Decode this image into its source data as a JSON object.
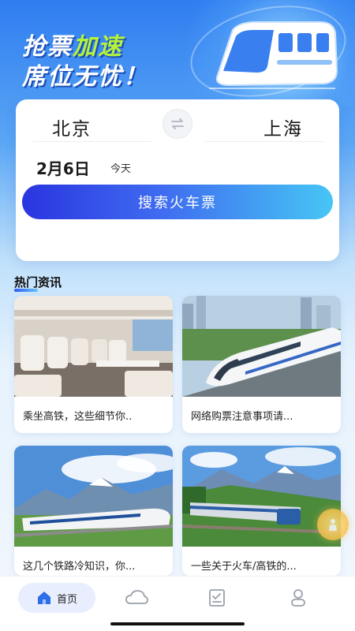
{
  "banner": {
    "line1_part1": "抢票",
    "line1_accent": "加速",
    "line2": "席位无忧！"
  },
  "search": {
    "from_city": "北京",
    "to_city": "上海",
    "date": "2月6日",
    "date_note": "今天",
    "button_label": "搜索火车票"
  },
  "news_section": {
    "title": "热门资讯",
    "items": [
      {
        "caption": "乘坐高铁，这些细节你.."
      },
      {
        "caption": "网络购票注意事项请..."
      },
      {
        "caption": "这几个铁路冷知识，你..."
      },
      {
        "caption": "一些关于火车/高铁的..."
      }
    ]
  },
  "tabbar": {
    "home_label": "首页"
  },
  "colors": {
    "primary": "#2f7df0",
    "button_start": "#2a35e0",
    "button_end": "#47c6f4",
    "slogan_accent": "#b7f23a"
  }
}
